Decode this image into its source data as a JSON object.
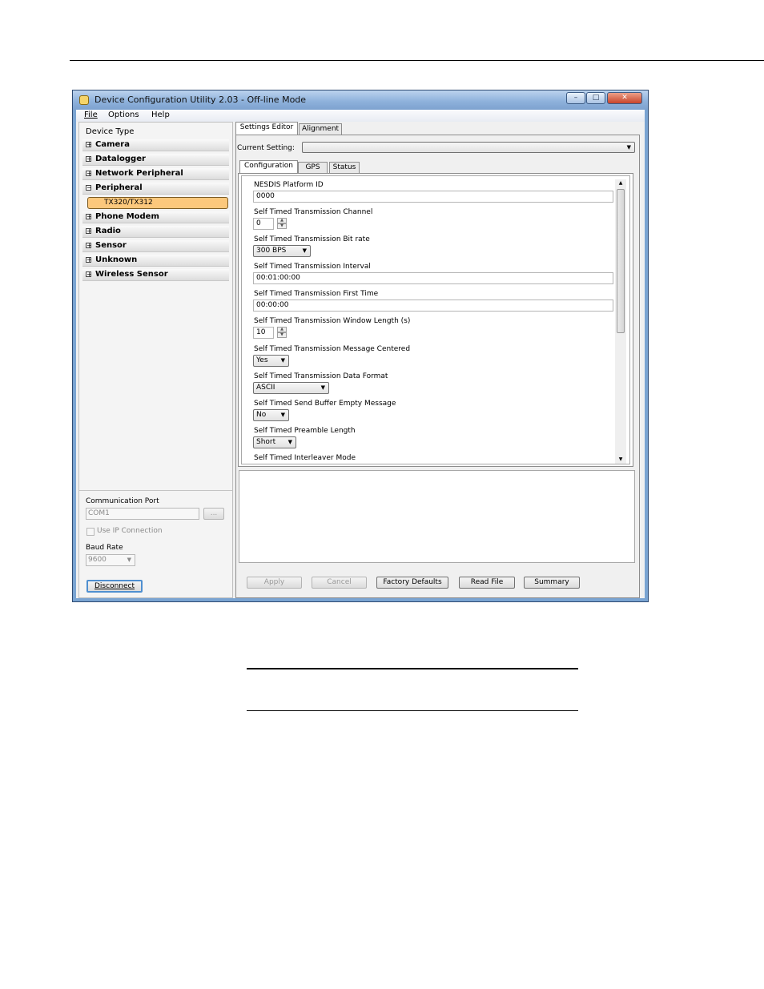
{
  "window": {
    "title": "Device Configuration Utility 2.03  - Off-line Mode",
    "controls": {
      "minimize": "–",
      "maximize": "□",
      "close": "✕"
    }
  },
  "menu": [
    "File",
    "Options",
    "Help"
  ],
  "device_type": {
    "label": "Device Type",
    "items": [
      "Camera",
      "Datalogger",
      "Network Peripheral",
      "Peripheral",
      "Phone Modem",
      "Radio",
      "Sensor",
      "Unknown",
      "Wireless Sensor"
    ],
    "selected_child": "TX320/TX312"
  },
  "connection": {
    "port_label": "Communication Port",
    "port_value": "COM1",
    "browse_label": "...",
    "use_ip_label": "Use IP Connection",
    "baud_label": "Baud Rate",
    "baud_value": "9600",
    "disconnect_label": "Disconnect"
  },
  "tabs": {
    "main": [
      "Settings Editor",
      "Alignment"
    ],
    "sub": [
      "Configuration",
      "GPS",
      "Status"
    ]
  },
  "current_setting_label": "Current Setting:",
  "fields": [
    {
      "label": "NESDIS Platform ID",
      "value": "0000"
    },
    {
      "label": "Self Timed Transmission Channel",
      "value": "0"
    },
    {
      "label": "Self Timed Transmission Bit rate",
      "value": "300 BPS"
    },
    {
      "label": "Self Timed Transmission Interval",
      "value": "00:01:00:00"
    },
    {
      "label": "Self Timed Transmission First Time",
      "value": "00:00:00"
    },
    {
      "label": "Self Timed Transmission Window Length (s)",
      "value": "10"
    },
    {
      "label": "Self Timed Transmission Message Centered",
      "value": "Yes"
    },
    {
      "label": "Self Timed Transmission Data Format",
      "value": "ASCII"
    },
    {
      "label": "Self Timed Send Buffer Empty Message",
      "value": "No"
    },
    {
      "label": "Self Timed Preamble Length",
      "value": "Short"
    },
    {
      "label": "Self Timed Interleaver Mode",
      "value": ""
    }
  ],
  "buttons": {
    "apply": "Apply",
    "cancel": "Cancel",
    "factory": "Factory Defaults",
    "read_file": "Read File",
    "summary": "Summary"
  }
}
